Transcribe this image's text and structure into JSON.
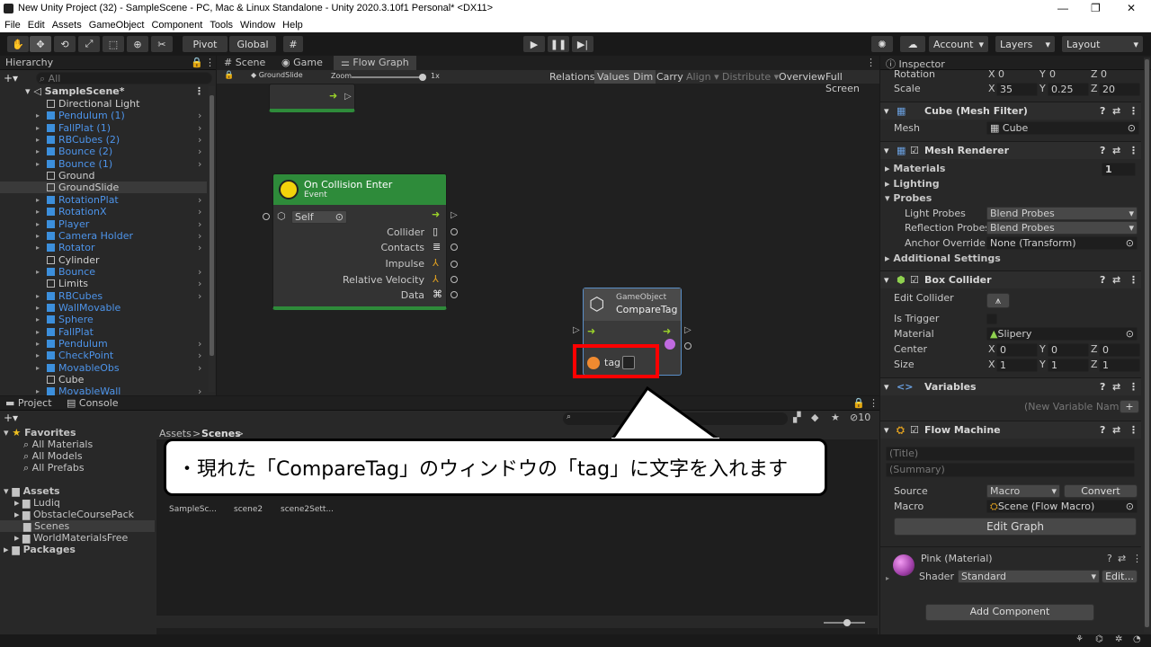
{
  "titlebar": {
    "title": "New Unity Project (32) - SampleScene - PC, Mac & Linux Standalone - Unity 2020.3.10f1 Personal* <DX11>"
  },
  "menu": [
    "File",
    "Edit",
    "Assets",
    "GameObject",
    "Component",
    "Tools",
    "Window",
    "Help"
  ],
  "toolbar": {
    "pivot": "Pivot",
    "global": "Global",
    "account": "Account",
    "layers": "Layers",
    "layout": "Layout"
  },
  "hierarchy": {
    "tab": "Hierarchy",
    "search_placeholder": "All",
    "scene": "SampleScene*",
    "items": [
      {
        "label": "Directional Light",
        "kind": "go",
        "exp": false
      },
      {
        "label": "Pendulum (1)",
        "kind": "prefab",
        "exp": true
      },
      {
        "label": "FallPlat (1)",
        "kind": "prefab",
        "exp": true
      },
      {
        "label": "RBCubes (2)",
        "kind": "prefab",
        "exp": true
      },
      {
        "label": "Bounce (2)",
        "kind": "prefab",
        "exp": true
      },
      {
        "label": "Bounce (1)",
        "kind": "prefab",
        "exp": true
      },
      {
        "label": "Ground",
        "kind": "go",
        "exp": false
      },
      {
        "label": "GroundSlide",
        "kind": "go",
        "exp": false,
        "selected": true
      },
      {
        "label": "RotationPlat",
        "kind": "prefab",
        "exp": true
      },
      {
        "label": "RotationX",
        "kind": "prefab",
        "exp": true
      },
      {
        "label": "Player",
        "kind": "prefab",
        "exp": true
      },
      {
        "label": "Camera Holder",
        "kind": "prefab",
        "exp": true
      },
      {
        "label": "Rotator",
        "kind": "prefab",
        "exp": true
      },
      {
        "label": "Cylinder",
        "kind": "go",
        "exp": false
      },
      {
        "label": "Bounce",
        "kind": "prefab",
        "exp": true
      },
      {
        "label": "Limits",
        "kind": "go",
        "exp": true
      },
      {
        "label": "RBCubes",
        "kind": "prefab",
        "exp": true
      },
      {
        "label": "WallMovable",
        "kind": "prefab",
        "exp": false
      },
      {
        "label": "Sphere",
        "kind": "prefab",
        "exp": false
      },
      {
        "label": "FallPlat",
        "kind": "prefab",
        "exp": false
      },
      {
        "label": "Pendulum",
        "kind": "prefab",
        "exp": true
      },
      {
        "label": "CheckPoint",
        "kind": "prefab",
        "exp": true
      },
      {
        "label": "MovableObs",
        "kind": "prefab",
        "exp": true
      },
      {
        "label": "Cube",
        "kind": "go",
        "exp": false
      },
      {
        "label": "MovableWall",
        "kind": "prefab",
        "exp": true
      }
    ]
  },
  "graph": {
    "tabs": [
      "Scene",
      "Game",
      "Flow Graph"
    ],
    "breadcrumb": "GroundSlide",
    "zoom_label": "Zoom",
    "zoom_value": "1x",
    "toolbar_items": [
      "Relations",
      "Values",
      "Dim",
      "Carry",
      "Align",
      "Distribute",
      "Overview",
      "Full Screen"
    ],
    "collision_node": {
      "title": "On Collision Enter",
      "subtitle": "Event",
      "self": "Self",
      "outputs": [
        "Collider",
        "Contacts",
        "Impulse",
        "Relative Velocity",
        "Data"
      ]
    },
    "compare_node": {
      "category": "GameObject",
      "title": "CompareTag",
      "tag_label": "tag"
    }
  },
  "project": {
    "tabs": [
      "Project",
      "Console"
    ],
    "favorites": "Favorites",
    "favorite_items": [
      "All Materials",
      "All Models",
      "All Prefabs"
    ],
    "assets": "Assets",
    "asset_folders": [
      "Ludiq",
      "ObstacleCoursePack",
      "Scenes",
      "WorldMaterialsFree"
    ],
    "packages": "Packages",
    "breadcrumb_root": "Assets",
    "breadcrumb_sep": ">",
    "breadcrumb_current": "Scenes",
    "files": [
      "SampleSc...",
      "scene2",
      "scene2Sett..."
    ],
    "hidden_count": "10"
  },
  "callout": {
    "text": "・現れた「CompareTag」のウィンドウの「tag」に文字を入れます"
  },
  "inspector": {
    "tab": "Inspector",
    "rotation": {
      "label": "Rotation",
      "x": "0",
      "y": "0",
      "z": "0"
    },
    "scale": {
      "label": "Scale",
      "x": "35",
      "y": "0.25",
      "z": "20"
    },
    "mesh_filter": {
      "title": "Cube (Mesh Filter)",
      "mesh_label": "Mesh",
      "mesh_value": "Cube"
    },
    "mesh_renderer": {
      "title": "Mesh Renderer",
      "materials": "Materials",
      "materials_count": "1",
      "lighting": "Lighting",
      "probes": "Probes",
      "light_probes": "Light Probes",
      "light_probes_value": "Blend Probes",
      "reflection_probes": "Reflection Probes",
      "reflection_probes_value": "Blend Probes",
      "anchor_override": "Anchor Override",
      "anchor_override_value": "None (Transform)",
      "additional": "Additional Settings"
    },
    "box_collider": {
      "title": "Box Collider",
      "edit_collider": "Edit Collider",
      "is_trigger": "Is Trigger",
      "material": "Material",
      "material_value": "Slipery",
      "center": {
        "label": "Center",
        "x": "0",
        "y": "0",
        "z": "0"
      },
      "size": {
        "label": "Size",
        "x": "1",
        "y": "1",
        "z": "1"
      }
    },
    "variables": {
      "title": "Variables",
      "placeholder": "(New Variable Name)"
    },
    "flow_machine": {
      "title": "Flow Machine",
      "title_ph": "(Title)",
      "summary_ph": "(Summary)",
      "source": "Source",
      "source_value": "Macro",
      "convert": "Convert",
      "macro": "Macro",
      "macro_value": "Scene (Flow Macro)",
      "edit_graph": "Edit Graph"
    },
    "material": {
      "name": "Pink (Material)",
      "shader_label": "Shader",
      "shader_value": "Standard",
      "edit": "Edit..."
    },
    "add_component": "Add Component"
  },
  "colors": {
    "node_green": "#2e8b3a",
    "accent_blue": "#4d94ea",
    "highlight_red": "#ff0000"
  }
}
